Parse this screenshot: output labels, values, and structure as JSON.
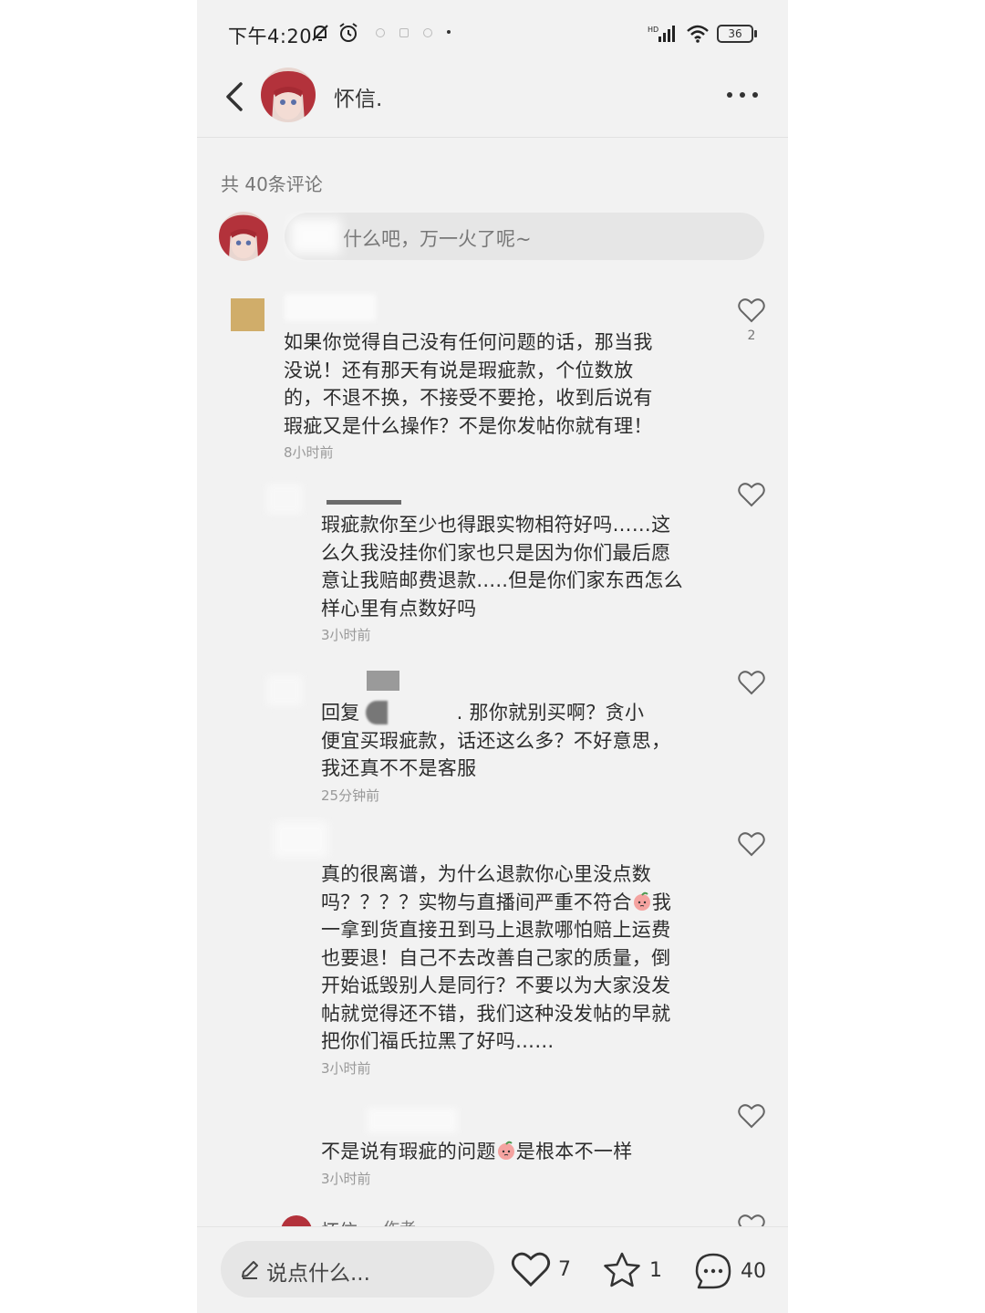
{
  "status_bar": {
    "time": "下午4:20",
    "battery": "36"
  },
  "header": {
    "author_name": "怀信."
  },
  "comments_section": {
    "count_label": "共 40条评论",
    "input_placeholder": "什么吧，万一火了呢~"
  },
  "comments": [
    {
      "text_lines": [
        "如果你觉得自己没有任何问题的话，那当我",
        "没说！还有那天有说是瑕疵款，个位数放",
        "的，不退不换，不接受不要抢，收到后说有",
        "瑕疵又是什么操作？不是你发帖你就有理！"
      ],
      "time": "8小时前",
      "likes": "2"
    },
    {
      "text_lines": [
        "瑕疵款你至少也得跟实物相符好吗……这",
        "么久我没挂你们家也只是因为你们最后愿",
        "意让我赔邮费退款.....但是你们家东西怎么",
        "样心里有点数好吗"
      ],
      "time": "3小时前"
    },
    {
      "reply_prefix": "回复",
      "reply_suffix": ". 那你就别买啊？贪小",
      "text_lines": [
        "便宜买瑕疵款，话还这么多？不好意思，",
        "我还真不不是客服"
      ],
      "time": "25分钟前"
    },
    {
      "text_lines": [
        "真的很离谱，为什么退款你心里没点数",
        "吗？？？？实物与直播间严重不符合",
        "我",
        "一拿到货直接丑到马上退款哪怕赔上运费",
        "也要退！自己不去改善自己家的质量，倒",
        "开始诋毁别人是同行？不要以为大家没发",
        "帖就觉得还不错，我们这种没发帖的早就",
        "把你们福氏拉黑了好吗……"
      ],
      "time": "3小时前"
    },
    {
      "text_before": "不是说有瑕疵的问题",
      "text_after": "是根本不一样",
      "time": "3小时前"
    }
  ],
  "partial_comment": {
    "name": "怀信.",
    "badge": "作者"
  },
  "bottom_bar": {
    "say_placeholder": "说点什么...",
    "likes": "7",
    "favorites": "1",
    "comments": "40"
  },
  "icons": [
    "back-arrow-icon",
    "more-dots-icon",
    "heart-icon",
    "star-icon",
    "comment-bubble-icon",
    "pencil-icon",
    "peach-emoji-icon",
    "alarm-icon",
    "mute-bell-icon",
    "signal-icon",
    "wifi-icon",
    "battery-icon"
  ]
}
